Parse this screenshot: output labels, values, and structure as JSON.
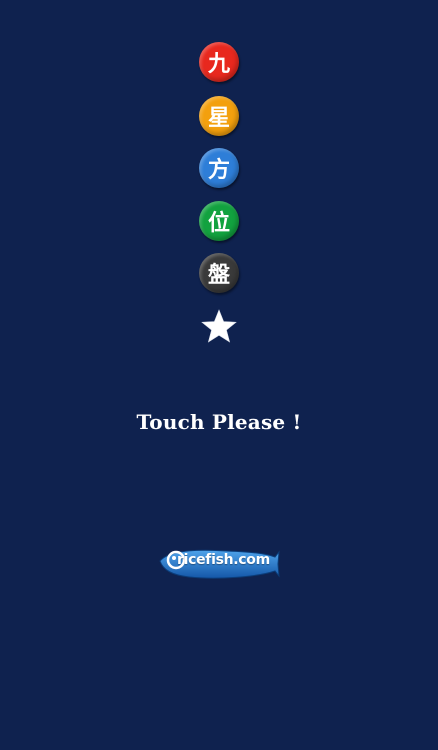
{
  "menu": {
    "items": [
      {
        "label": "九",
        "color": "#e8281e"
      },
      {
        "label": "星",
        "color": "#f3a00e"
      },
      {
        "label": "方",
        "color": "#2e7ed8"
      },
      {
        "label": "位",
        "color": "#12a23f"
      },
      {
        "label": "盤",
        "color": "#3a3a3a"
      }
    ],
    "star_icon": "star-icon"
  },
  "prompt": {
    "text": "Touch Please !"
  },
  "brand": {
    "logo_text": "ricefish.com",
    "logo_color": "#1f74c8"
  },
  "theme": {
    "background": "#0f224f"
  }
}
